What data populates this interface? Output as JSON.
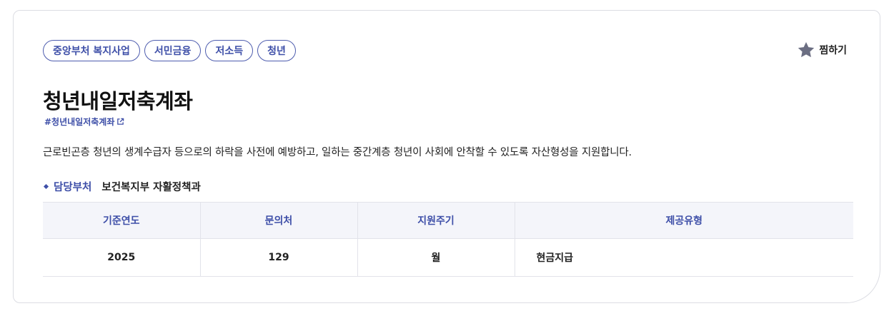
{
  "tags": [
    "중앙부처 복지사업",
    "서민금융",
    "저소득",
    "청년"
  ],
  "favorite": {
    "label": "찜하기",
    "icon": "star-icon"
  },
  "title": "청년내일저축계좌",
  "hashtag": {
    "text": "#청년내일저축계좌",
    "icon": "external-link-icon"
  },
  "description": "근로빈곤층 청년의 생계수급자 등으로의 하락을 사전에 예방하고, 일하는 중간계층 청년이 사회에 안착할 수 있도록 자산형성을 지원합니다.",
  "department": {
    "label": "담당부처",
    "value": "보건복지부 자활정책과"
  },
  "table": {
    "headers": [
      "기준연도",
      "문의처",
      "지원주기",
      "제공유형"
    ],
    "row": [
      "2025",
      "129",
      "월",
      "현금지급"
    ]
  },
  "colors": {
    "accent": "#3e4fa8",
    "star": "#6b6e82",
    "header_bg": "#f4f5fa"
  }
}
